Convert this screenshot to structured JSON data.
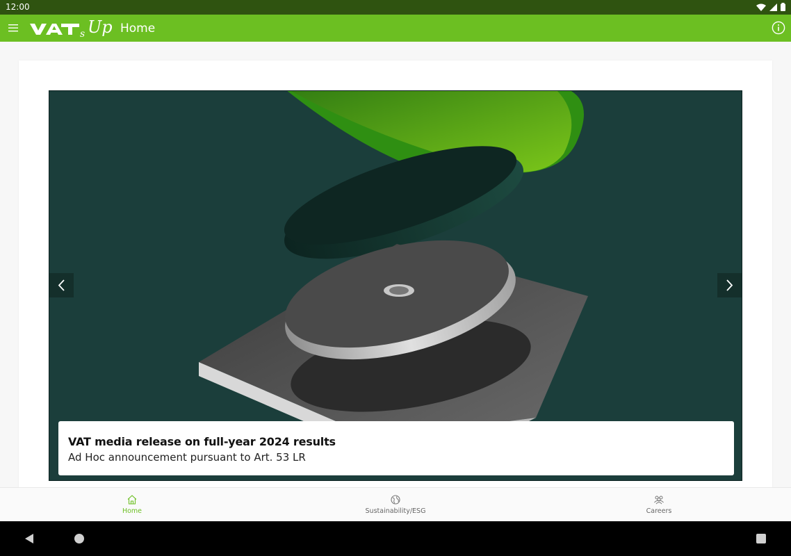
{
  "status_bar": {
    "time": "12:00",
    "icons": [
      "wifi-icon",
      "signal-icon",
      "battery-icon"
    ]
  },
  "app_bar": {
    "logo_text": "VAT",
    "logo_suffix": "sUp",
    "title": "Home",
    "color": "#6cbf22"
  },
  "carousel": {
    "current_slide": {
      "title": "VAT media release on full-year 2024 results",
      "subtitle": "Ad Hoc announcement pursuant to Art. 53 LR"
    },
    "prev_icon": "chevron-left-icon",
    "next_icon": "chevron-right-icon"
  },
  "bottom_nav": {
    "items": [
      {
        "label": "Home",
        "icon": "home-icon",
        "active": true
      },
      {
        "label": "Sustainability/ESG",
        "icon": "globe-icon",
        "active": false
      },
      {
        "label": "Careers",
        "icon": "people-icon",
        "active": false
      }
    ],
    "active_color": "#6cbf22"
  },
  "system_nav": {
    "icons": [
      "back-icon",
      "home-circle-icon",
      "recents-icon"
    ]
  }
}
